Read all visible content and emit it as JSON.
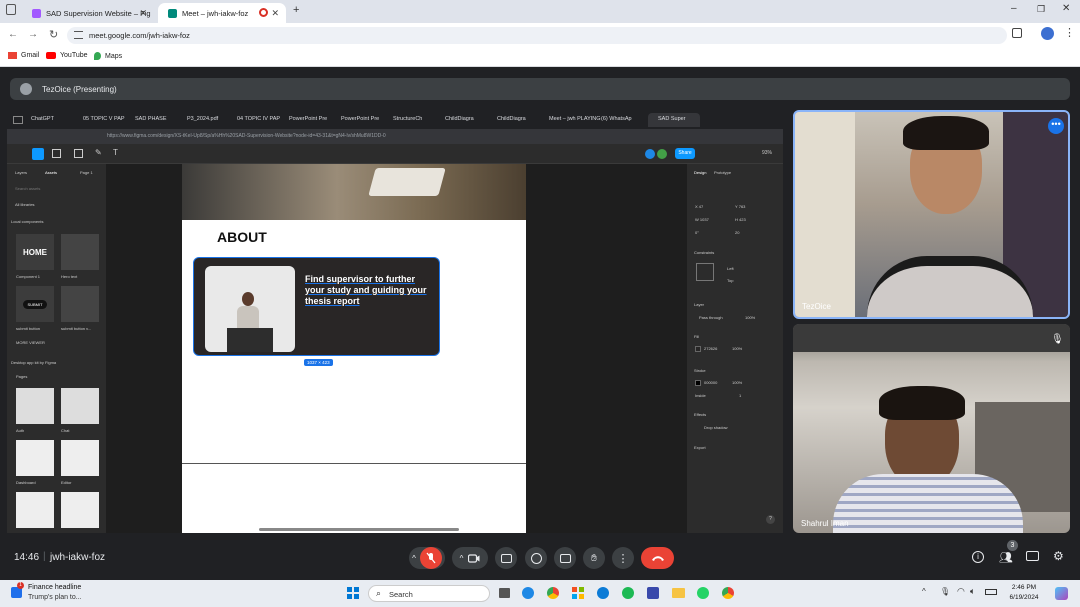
{
  "browser": {
    "tabs": [
      {
        "label": "SAD Supervision Website – Fig"
      },
      {
        "label": "Meet – jwh-iakw-foz"
      }
    ],
    "url": "meet.google.com/jwh-iakw-foz",
    "bookmarks": [
      "Gmail",
      "YouTube",
      "Maps"
    ]
  },
  "meet": {
    "presenting_label": "TezOice (Presenting)",
    "time": "14:46",
    "meeting_code": "jwh-iakw-foz",
    "people_count": "3",
    "participants": [
      {
        "name": "TezOice"
      },
      {
        "name": "Shahrul Iman"
      }
    ]
  },
  "shared": {
    "inner_tabs": [
      "ChatGPT",
      "05 TOPIC V PAP",
      "SAD PHASE",
      "P3_2024.pdf",
      "04 TOPIC IV PAP",
      "PowerPoint Pre",
      "PowerPoint Pre",
      "StructureCh",
      "ChildDiagra",
      "ChildDiagra",
      "Meet – jwh PLAYING",
      "(6) WhatsAp",
      "SAD Super"
    ],
    "inner_url": "https://www.figma.com/design/XS-tKeI-Up8/Sp/a%Hh%20SAD-Supervision-Website?node-id=43-31&t=gN4-lv/shMu8W1DD-0",
    "left_panel": {
      "tabs": [
        "Layers",
        "Assets",
        "Page 1"
      ],
      "search": "Search assets",
      "all_libraries": "All libraries",
      "section_local": "Local components",
      "components": [
        "Component 1",
        "Hero text",
        "submit button",
        "submit button v..."
      ],
      "home_label": "HOME",
      "submit_label": "SUBMIT",
      "more_label": "MORE VIEWER",
      "section_kit": "Desktop app kit by Figma",
      "pages_label": "Pages",
      "pages": [
        "Auth",
        "Chat",
        "Dashboard",
        "Editor"
      ]
    },
    "canvas": {
      "about_heading": "ABOUT",
      "card_text": "Find supervisor to further your study and guiding your thesis report",
      "size_badge": "1037 × 423"
    },
    "right_panel": {
      "tabs": [
        "Design",
        "Prototype"
      ],
      "x": "47",
      "y": "763",
      "w": "1037",
      "h": "423",
      "rot": "0°",
      "radius": "20",
      "constraints": "Constraints",
      "left": "Left",
      "top": "Top",
      "layer": "Layer",
      "pass_through": "Pass through",
      "opacity": "100%",
      "fill": "Fill",
      "fill_hex": "272626",
      "fill_op": "100%",
      "stroke": "Stroke",
      "stroke_hex": "000000",
      "stroke_op": "100%",
      "inside": "Inside",
      "stroke_w": "1",
      "effects": "Effects",
      "drop_shadow": "Drop shadow",
      "export": "Export",
      "share": "Share",
      "zoom": "93%"
    }
  },
  "taskbar": {
    "news_title": "Finance headline",
    "news_sub": "Trump's plan to...",
    "search_placeholder": "Search",
    "clock_time": "2:46 PM",
    "clock_date": "6/19/2024"
  },
  "colors": {
    "meet_bg": "#202124",
    "end_call": "#ea4335",
    "figma_blue": "#1a73e8",
    "card_bg": "#292626"
  }
}
